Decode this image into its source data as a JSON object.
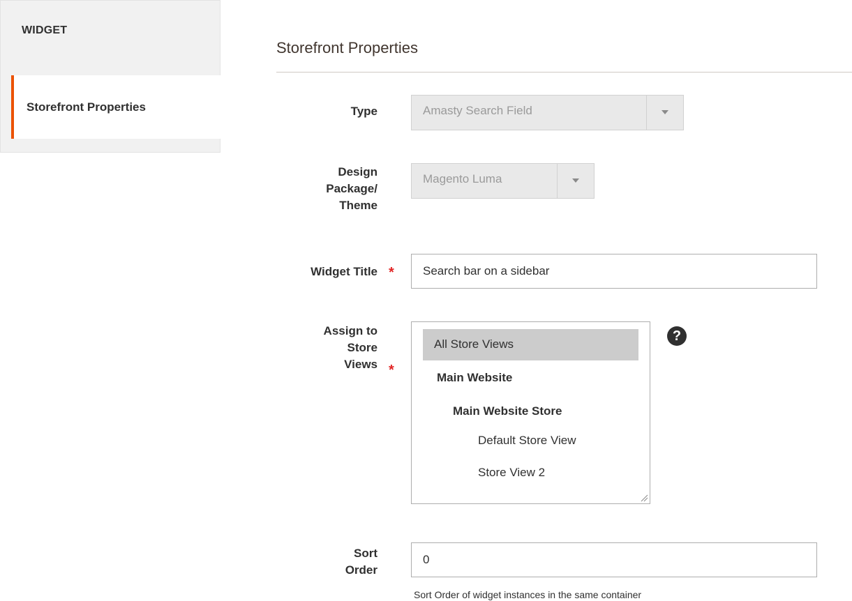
{
  "sidebar": {
    "title": "WIDGET",
    "items": [
      {
        "label": "Storefront Properties",
        "active": true
      }
    ],
    "accent_color": "#eb5202"
  },
  "main": {
    "section_title": "Storefront Properties",
    "fields": {
      "type": {
        "label": "Type",
        "value": "Amasty Search Field",
        "disabled": true
      },
      "design": {
        "label_lines": [
          "Design",
          "Package/",
          "Theme"
        ],
        "value": "Magento Luma",
        "disabled": true
      },
      "widget_title": {
        "label": "Widget Title",
        "required": true,
        "value": "Search bar on a sidebar"
      },
      "store_views": {
        "label_lines": [
          "Assign to",
          "Store",
          "Views"
        ],
        "required": true,
        "options": [
          {
            "label": "All Store Views",
            "selected": true
          },
          {
            "label": "Main Website",
            "group": true
          },
          {
            "label": "Main Website Store",
            "group": true
          },
          {
            "label": "Default Store View"
          },
          {
            "label": "Store View 2"
          }
        ],
        "help_icon": "question-circle-icon"
      },
      "sort_order": {
        "label_lines": [
          "Sort",
          "Order"
        ],
        "value": "0",
        "note": "Sort Order of widget instances in the same container"
      }
    },
    "required_marker": "*",
    "required_color": "#e22626"
  }
}
